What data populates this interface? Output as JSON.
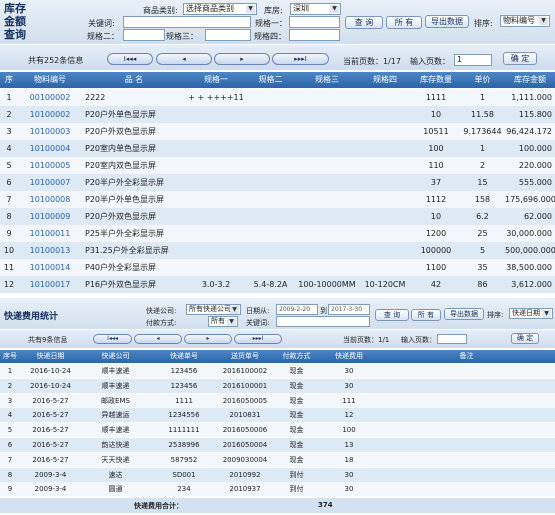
{
  "title_lines": [
    "库存",
    "金额",
    "查询"
  ],
  "filters": {
    "cat_label": "商品类别:",
    "cat_value": "选择商品类别",
    "wh_label": "库房:",
    "wh_value": "深圳",
    "kw_label": "关键词:",
    "s1_label": "规格一：",
    "s2_label": "规格二：",
    "s3_label": "规格三：",
    "s4_label": "规格四：",
    "query": "查 询",
    "all": "所 有",
    "export": "导出数据",
    "sort_label": "排序:",
    "sort_value": "物料编号"
  },
  "pager": {
    "total": "共有252条信息",
    "first": "I◂◂◂",
    "prev": "◂",
    "next": "▸",
    "last": "▸▸▸I",
    "page_info": "当前页数：1/17",
    "goto_label": "输入页数：",
    "goto_value": "1",
    "ok": "确 定"
  },
  "inventory": {
    "headers": [
      "序 号",
      "物料编号",
      "品 名",
      "规格一",
      "规格二",
      "规格三",
      "规格四",
      "库存数量",
      "单价",
      "库存金额"
    ],
    "rows": [
      [
        "1",
        "00100002",
        "2222",
        "+ + ++++11",
        "",
        "",
        "",
        "1111",
        "1",
        "1,111.000"
      ],
      [
        "2",
        "10100002",
        "P20户外单色显示屏",
        "",
        "",
        "",
        "",
        "10",
        "11.58",
        "115.800"
      ],
      [
        "3",
        "10100003",
        "P20户外双色显示屏",
        "",
        "",
        "",
        "",
        "10511",
        "9.173644",
        "96,424.172"
      ],
      [
        "4",
        "10100004",
        "P20室内单色显示屏",
        "",
        "",
        "",
        "",
        "100",
        "1",
        "100.000"
      ],
      [
        "5",
        "10100005",
        "P20室内双色显示屏",
        "",
        "",
        "",
        "",
        "110",
        "2",
        "220.000"
      ],
      [
        "6",
        "10100007",
        "P20半户外全彩显示屏",
        "",
        "",
        "",
        "",
        "37",
        "15",
        "555.000"
      ],
      [
        "7",
        "10100008",
        "P20半户外单色显示屏",
        "",
        "",
        "",
        "",
        "1112",
        "158",
        "175,696.000"
      ],
      [
        "8",
        "10100009",
        "P20户外双色显示屏",
        "",
        "",
        "",
        "",
        "10",
        "6.2",
        "62.000"
      ],
      [
        "9",
        "10100011",
        "P25半户外全彩显示屏",
        "",
        "",
        "",
        "",
        "1200",
        "25",
        "30,000.000"
      ],
      [
        "10",
        "10100013",
        "P31.25户外全彩显示屏",
        "",
        "",
        "",
        "",
        "100000",
        "5",
        "500,000.000"
      ],
      [
        "11",
        "10100014",
        "P40户外全彩显示屏",
        "",
        "",
        "",
        "",
        "1100",
        "35",
        "38,500.000"
      ],
      [
        "12",
        "10100017",
        "P16户外双色显示屏",
        "3.0-3.2",
        "5.4-8.2A",
        "100-10000MM",
        "10-120CM",
        "42",
        "86",
        "3,612.000"
      ]
    ]
  },
  "express": {
    "title": "快递费用统计",
    "company_label": "快递公司:",
    "company_value": "所有快递公司",
    "date_label": "日期从:",
    "date_from": "2009-2-20",
    "to_label": "到",
    "date_to": "2017-3-30",
    "pay_label": "付款方式:",
    "pay_value": "所有",
    "kw_label": "关键词:",
    "query": "查 询",
    "all": "所 有",
    "export": "导出数据",
    "sort_label": "排序:",
    "sort_value": "快递日期",
    "total": "共有9条信息",
    "page_info": "当前页数：1/1",
    "goto_label": "输入页数：",
    "goto_value": "",
    "ok": "确 定",
    "headers": [
      "序号",
      "快递日期",
      "快递公司",
      "快递单号",
      "送货单号",
      "付款方式",
      "快递费用",
      "备注"
    ],
    "rows": [
      [
        "1",
        "2016-10-24",
        "顺丰速递",
        "123456",
        "2016100002",
        "现金",
        "30",
        ""
      ],
      [
        "2",
        "2016-10-24",
        "顺丰速递",
        "123456",
        "2016100001",
        "现金",
        "30",
        ""
      ],
      [
        "3",
        "2016-5-27",
        "邮政EMS",
        "1111",
        "2016050005",
        "现金",
        "111",
        ""
      ],
      [
        "4",
        "2016-5-27",
        "异越速运",
        "1234556",
        "2010831",
        "现金",
        "12",
        ""
      ],
      [
        "5",
        "2016-5-27",
        "顺丰速递",
        "1111111",
        "2016050006",
        "现金",
        "100",
        ""
      ],
      [
        "6",
        "2016-5-27",
        "韵达快递",
        "2538996",
        "2016050004",
        "现金",
        "13",
        ""
      ],
      [
        "7",
        "2016-5-27",
        "天天快递",
        "587952",
        "2009030004",
        "现金",
        "18",
        ""
      ],
      [
        "8",
        "2009-3-4",
        "速达",
        "SD001",
        "2010992",
        "到付",
        "30",
        ""
      ],
      [
        "9",
        "2009-3-4",
        "圆通",
        "234",
        "2010937",
        "到付",
        "30",
        ""
      ]
    ],
    "sum_label": "快递费用合计：",
    "sum_value": "374"
  },
  "colors": {
    "header_bg": "#3a74b8",
    "row_alt": "#dde9f5",
    "title": "#15315d",
    "link": "#2b64a8"
  }
}
